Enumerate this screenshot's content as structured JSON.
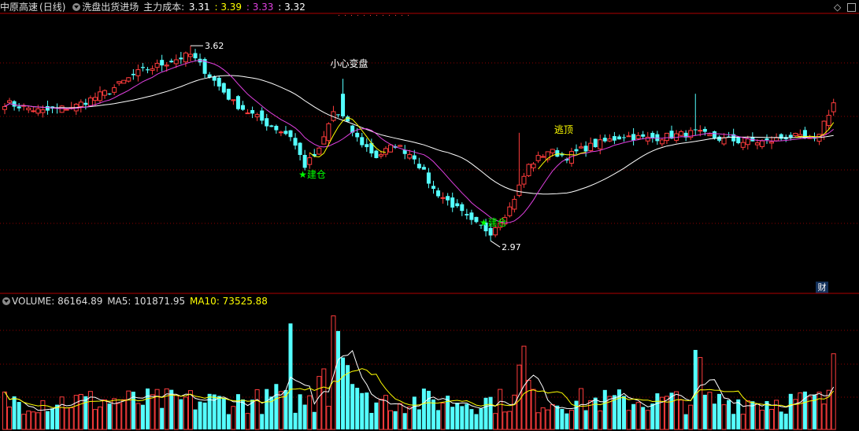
{
  "header": {
    "stock_name": "中原高速",
    "period": "(日线)",
    "indicator": "洗盘出货进场",
    "cost_label": "主力成本:",
    "cost_values": [
      {
        "text": "3.31",
        "color": "#ffffff"
      },
      {
        "text": ": 3.39",
        "color": "#ffff00"
      },
      {
        "text": ": 3.33",
        "color": "#e040e0"
      },
      {
        "text": ": 3.32",
        "color": "#ffffff"
      }
    ]
  },
  "volume_header": {
    "label": "VOLUME: 86164.89",
    "ma5": "MA5: 101871.95",
    "ma10": "MA10: 73525.88"
  },
  "finance_badge": "财",
  "colors": {
    "up": "#ff3c3c",
    "down": "#54ffff",
    "ma_white": "#ffffff",
    "ma_purple": "#e040e0",
    "ma_yellow": "#ffff00",
    "grid": "#8b0000",
    "signal_green": "#00ff00",
    "annotation_white": "#ffffff",
    "annotation_yellow": "#ffff00"
  },
  "chart_data": {
    "type": "candlestick",
    "price_range": [
      2.85,
      3.72
    ],
    "volume_range": [
      0,
      160000
    ],
    "annotations": [
      {
        "text": "3.62",
        "index": 39,
        "value": 3.62,
        "kind": "high",
        "color": "#ffffff"
      },
      {
        "text": "2.97",
        "index": 102,
        "value": 2.97,
        "kind": "low",
        "color": "#ffffff"
      },
      {
        "text": "小心变盘",
        "index": 70,
        "value": 3.55,
        "kind": "label",
        "color": "#ffffff"
      },
      {
        "text": "逃顶",
        "index": 117,
        "value": 3.33,
        "kind": "label",
        "color": "#ffff00"
      },
      {
        "text": "★建仓",
        "index": 63,
        "value": 3.18,
        "kind": "signal",
        "color": "#00ff00"
      },
      {
        "text": "★建仓",
        "index": 101,
        "value": 3.02,
        "kind": "signal",
        "color": "#00ff00"
      }
    ]
  }
}
